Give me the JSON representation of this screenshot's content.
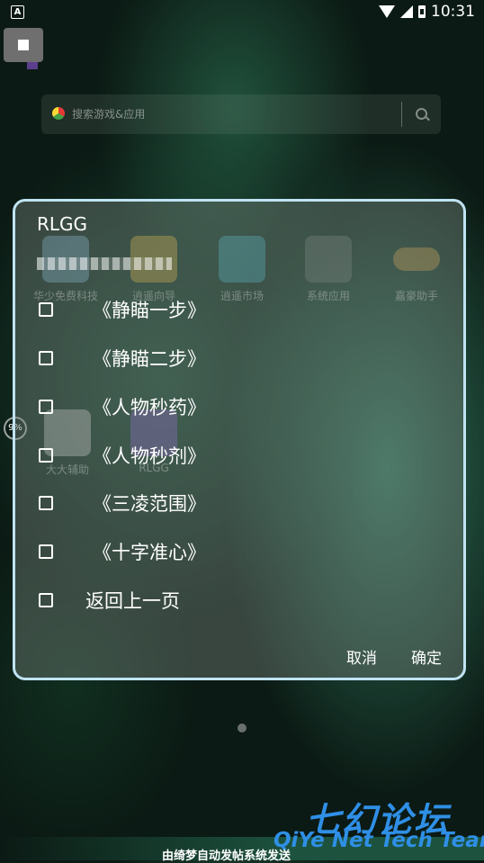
{
  "status": {
    "indicator": "A",
    "time": "10:31"
  },
  "search": {
    "placeholder": "搜索游戏&应用"
  },
  "apps": [
    {
      "name": "华少免费科技"
    },
    {
      "name": "逍遥向导"
    },
    {
      "name": "逍遥市场"
    },
    {
      "name": "系统应用"
    },
    {
      "name": "嘉豪助手"
    },
    {
      "name": "大大辅助"
    },
    {
      "name": "RLGG"
    }
  ],
  "dialog": {
    "title": "RLGG",
    "options": [
      {
        "label": "《静瞄一步》",
        "checked": false
      },
      {
        "label": "《静瞄二步》",
        "checked": false
      },
      {
        "label": "《人物秒药》",
        "checked": false
      },
      {
        "label": "《人物秒剂》",
        "checked": false
      },
      {
        "label": "《三凌范围》",
        "checked": false
      },
      {
        "label": "《十字准心》",
        "checked": false
      },
      {
        "label": "返回上一页",
        "checked": false
      }
    ],
    "cancel": "取消",
    "confirm": "确定"
  },
  "side_badge": "9%",
  "watermark": {
    "cn": "七幻论坛",
    "en": "QiYe Net Tech Team",
    "bottom": "由绮梦自动发帖系统发送"
  }
}
